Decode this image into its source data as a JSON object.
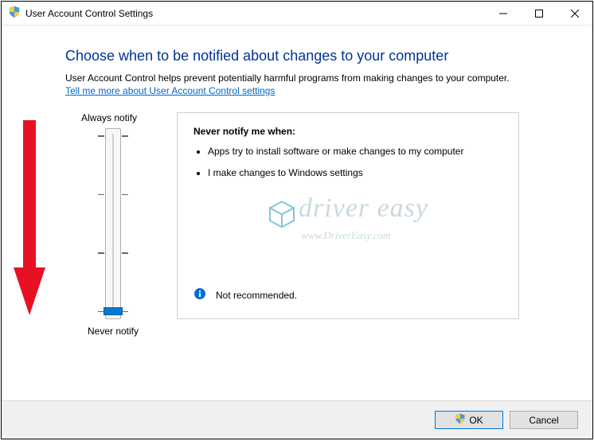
{
  "window": {
    "title": "User Account Control Settings"
  },
  "content": {
    "heading": "Choose when to be notified about changes to your computer",
    "description": "User Account Control helps prevent potentially harmful programs from making changes to your computer.",
    "link": "Tell me more about User Account Control settings"
  },
  "slider": {
    "top_label": "Always notify",
    "bottom_label": "Never notify"
  },
  "notify_box": {
    "title": "Never notify me when:",
    "items": [
      "Apps try to install software or make changes to my computer",
      "I make changes to Windows settings"
    ],
    "recommend": "Not recommended."
  },
  "watermark": {
    "line1": "driver easy",
    "line2": "www.DriverEasy.com"
  },
  "buttons": {
    "ok": "OK",
    "cancel": "Cancel"
  }
}
